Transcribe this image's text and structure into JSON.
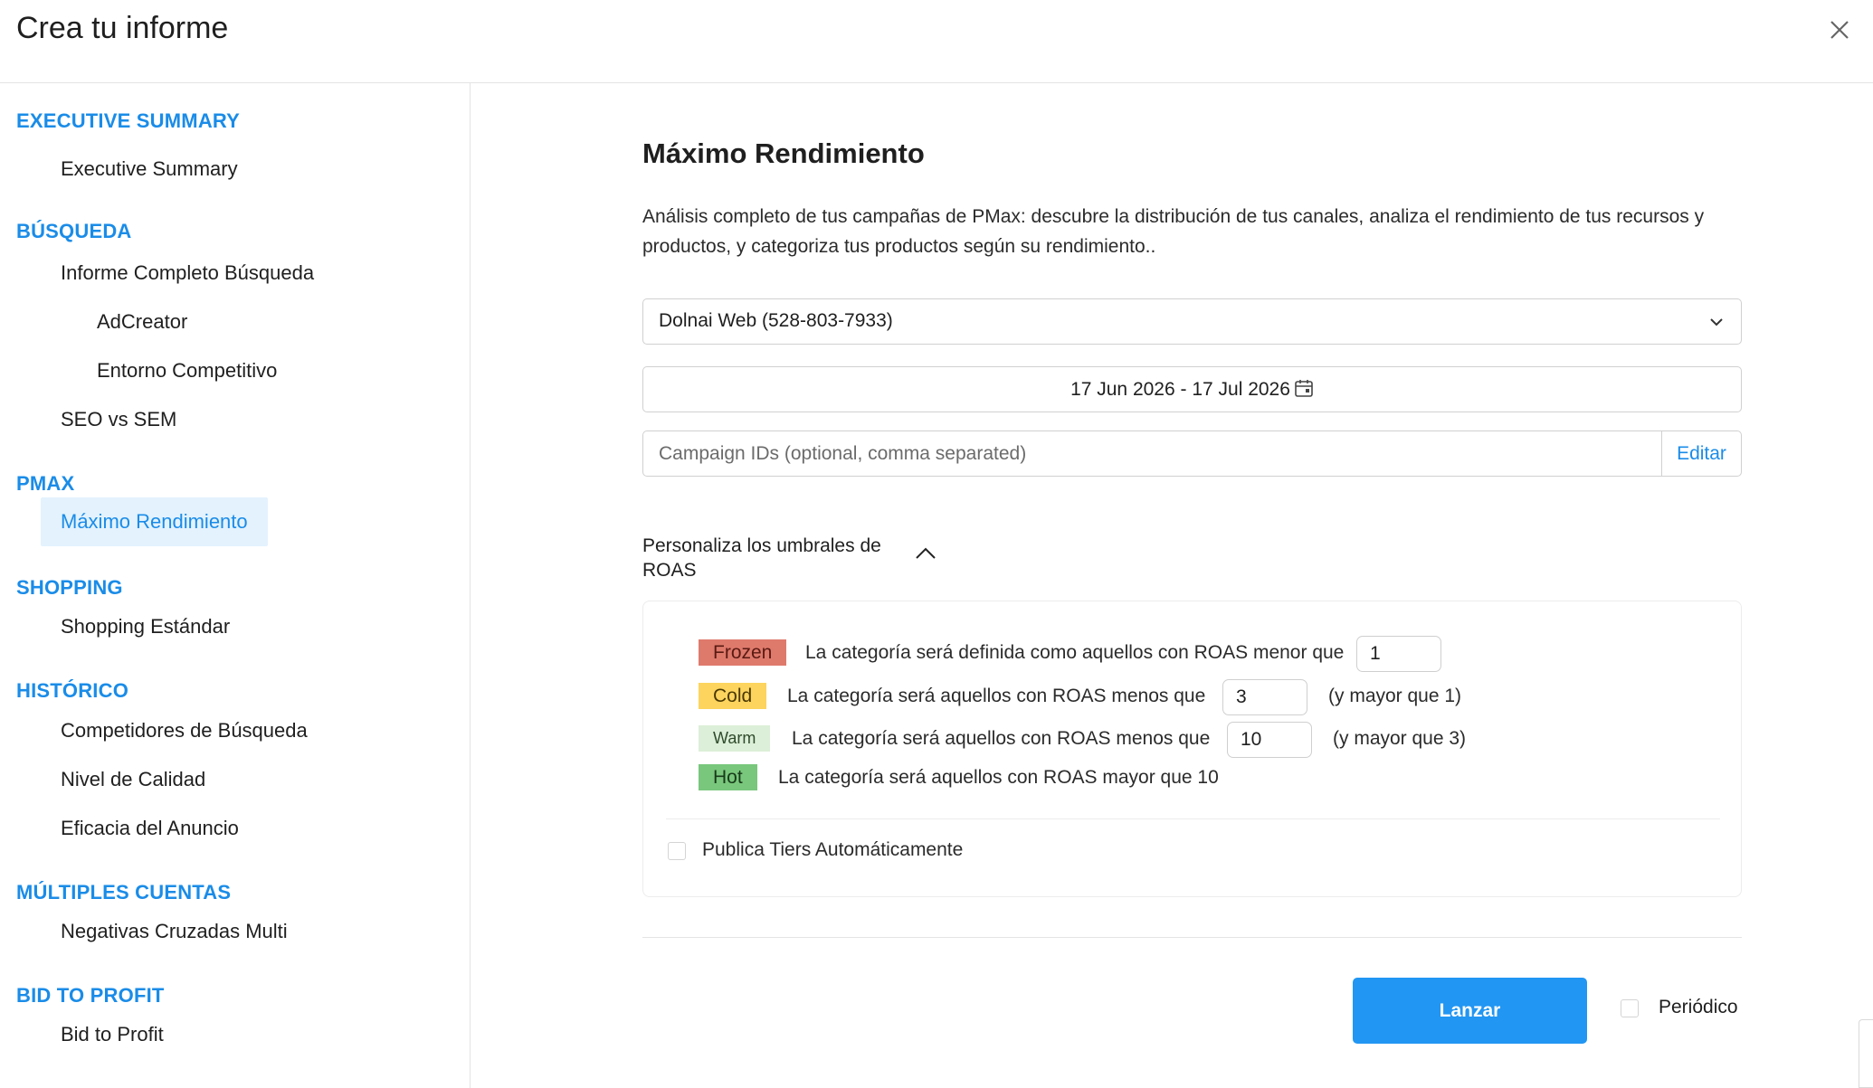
{
  "header": {
    "title": "Crea tu informe",
    "close_icon": "close-icon"
  },
  "sidebar": {
    "sections": [
      {
        "title": "EXECUTIVE SUMMARY",
        "items": [
          {
            "label": "Executive Summary"
          }
        ]
      },
      {
        "title": "BÚSQUEDA",
        "items": [
          {
            "label": "Informe Completo Búsqueda"
          },
          {
            "label": "AdCreator"
          },
          {
            "label": "Entorno Competitivo"
          },
          {
            "label": "SEO vs SEM"
          }
        ]
      },
      {
        "title": "PMAX",
        "items": [
          {
            "label": "Máximo Rendimiento",
            "active": true
          }
        ]
      },
      {
        "title": "SHOPPING",
        "items": [
          {
            "label": "Shopping Estándar"
          }
        ]
      },
      {
        "title": "HISTÓRICO",
        "items": [
          {
            "label": "Competidores de Búsqueda"
          },
          {
            "label": "Nivel de Calidad"
          },
          {
            "label": "Eficacia del Anuncio"
          }
        ]
      },
      {
        "title": "MÚLTIPLES CUENTAS",
        "items": [
          {
            "label": "Negativas Cruzadas Multi"
          }
        ]
      },
      {
        "title": "BID TO PROFIT",
        "items": [
          {
            "label": "Bid to Profit"
          }
        ]
      }
    ]
  },
  "main": {
    "title": "Máximo Rendimiento",
    "description": "Análisis completo de tus campañas de PMax: descubre la distribución de tus canales, analiza el rendimiento de tus recursos y productos, y categoriza tus productos según su rendimiento..",
    "account_select": {
      "value": "Dolnai Web (528-803-7933)"
    },
    "date_range": {
      "value": "17 Jun 2026 - 17 Jul 2026"
    },
    "campaign_ids": {
      "placeholder": "Campaign IDs (optional, comma separated)",
      "value": "",
      "edit_label": "Editar"
    },
    "roas": {
      "toggle_label": "Personaliza los umbrales de ROAS",
      "expanded": true,
      "tiers": [
        {
          "name": "Frozen",
          "text": "La categoría será definida como aquellos con ROAS menor que",
          "value": "1",
          "suffix": "",
          "color": "#de7a6c"
        },
        {
          "name": "Cold",
          "text": "La categoría será aquellos con ROAS menos que",
          "value": "3",
          "suffix": "(y mayor que 1)",
          "color": "#fcd45e"
        },
        {
          "name": "Warm",
          "text": "La categoría será aquellos con ROAS menos que",
          "value": "10",
          "suffix": "(y mayor que 3)",
          "color": "#dcefd8"
        },
        {
          "name": "Hot",
          "text": "La categoría será aquellos con ROAS mayor que 10",
          "color": "#79c77c"
        }
      ],
      "auto_publish_label": "Publica Tiers Automáticamente",
      "auto_publish_checked": false
    },
    "launch_label": "Lanzar",
    "periodic_label": "Periódico",
    "periodic_checked": false
  },
  "colors": {
    "accent": "#1a8ce8",
    "button": "#2196f3",
    "active_bg": "#e3f2fd"
  }
}
